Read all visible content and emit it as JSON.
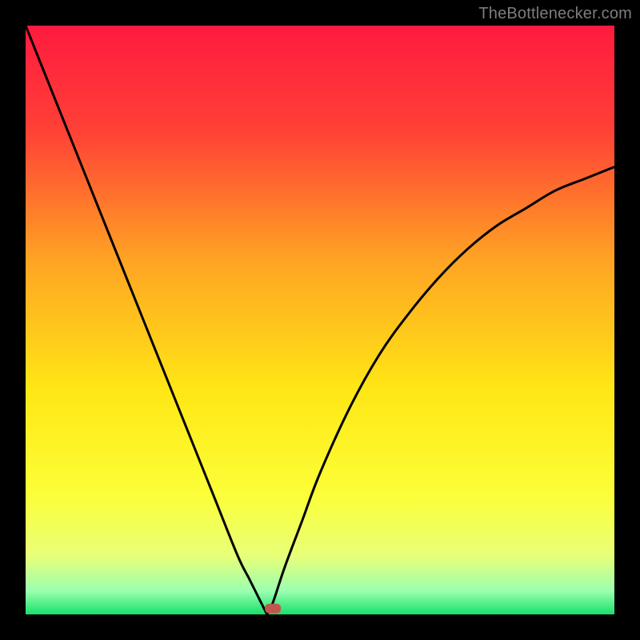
{
  "attribution": "TheBottlenecker.com",
  "chart_data": {
    "type": "line",
    "title": "",
    "xlabel": "",
    "ylabel": "",
    "xlim": [
      0,
      100
    ],
    "ylim": [
      0,
      100
    ],
    "gradient_stops": [
      {
        "offset": 0,
        "color": "#ff1a3f"
      },
      {
        "offset": 18,
        "color": "#ff4136"
      },
      {
        "offset": 40,
        "color": "#ffa423"
      },
      {
        "offset": 62,
        "color": "#ffe715"
      },
      {
        "offset": 80,
        "color": "#fbff39"
      },
      {
        "offset": 90,
        "color": "#e8ff78"
      },
      {
        "offset": 96,
        "color": "#9bffb0"
      },
      {
        "offset": 100,
        "color": "#18e06a"
      }
    ],
    "vertex": {
      "x": 41,
      "y": 0
    },
    "marker": {
      "x": 42,
      "y": 1,
      "color": "#c0574e"
    },
    "series": [
      {
        "name": "left-branch",
        "x": [
          0,
          4,
          8,
          12,
          16,
          20,
          24,
          28,
          32,
          36,
          38,
          40,
          41
        ],
        "y": [
          100,
          90,
          80,
          70,
          60,
          50,
          40,
          30,
          20,
          10,
          6,
          2,
          0
        ]
      },
      {
        "name": "right-branch",
        "x": [
          41,
          42,
          44,
          47,
          50,
          55,
          60,
          65,
          70,
          75,
          80,
          85,
          90,
          95,
          100
        ],
        "y": [
          0,
          2,
          8,
          16,
          24,
          35,
          44,
          51,
          57,
          62,
          66,
          69,
          72,
          74,
          76
        ]
      }
    ]
  }
}
